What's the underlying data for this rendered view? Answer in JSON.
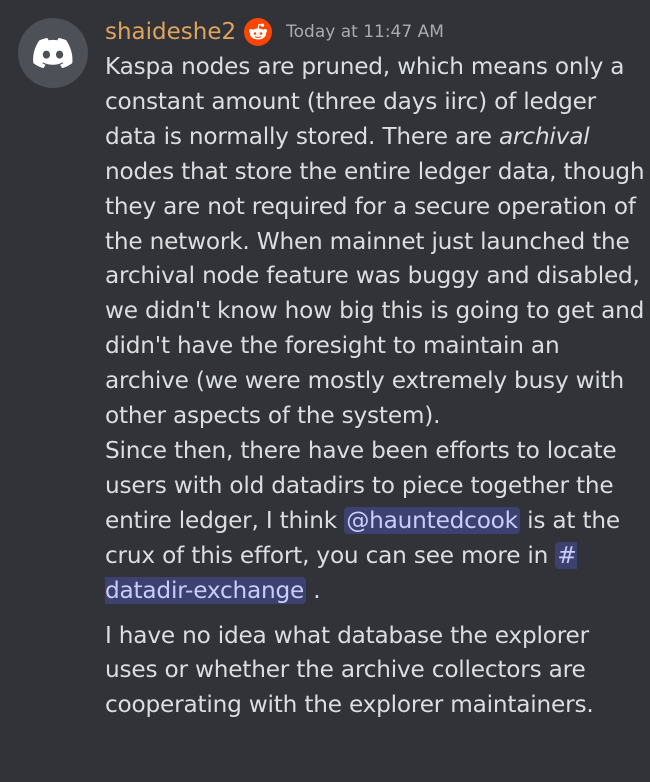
{
  "message": {
    "username": "shaideshe2",
    "timestamp": "Today at 11:47 AM",
    "badge_icon": "reddit-icon",
    "avatar_icon": "discord-icon",
    "paragraph1_a": "Kaspa nodes are pruned, which means only a constant amount (three days iirc) of ledger data is normally stored. There are ",
    "paragraph1_em": "archival",
    "paragraph1_b": " nodes that store the entire ledger data, though they are not required for a secure operation of the network. When mainnet just launched the archival node feature was buggy and disabled, we didn't know how big this is going to get and didn't have the foresight to maintain an archive (we were mostly extremely busy with other aspects of the system).",
    "paragraph2_a": "Since then, there have been efforts to locate users with old datadirs to piece together the entire ledger, I think ",
    "mention_user": "@hauntedcook",
    "paragraph2_b": " is at the crux of this effort, you can see more in ",
    "mention_channel_hash": "#",
    "mention_channel_name": "datadir-exchange",
    "paragraph2_c": " .",
    "paragraph3": "I have no idea what database the explorer uses or whether the archive collectors are cooperating with the explorer maintainers."
  },
  "colors": {
    "background": "#313338",
    "username": "#e0a45c",
    "mention_bg": "#3c4170",
    "text": "#dbdee1"
  }
}
